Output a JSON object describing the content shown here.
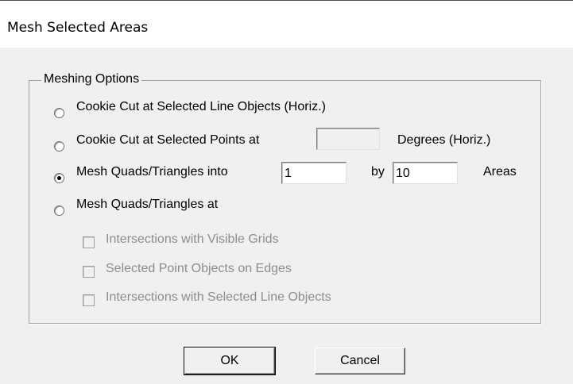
{
  "window": {
    "title": "Mesh Selected Areas"
  },
  "group": {
    "label": "Meshing Options"
  },
  "options": [
    {
      "label": "Cookie Cut at Selected Line Objects (Horiz.)",
      "checked": false
    },
    {
      "label": "Cookie Cut at Selected Points at",
      "suffix": "Degrees (Horiz.)",
      "value": "",
      "checked": false
    },
    {
      "label": "Mesh Quads/Triangles into",
      "value1": "1",
      "by": "by",
      "value2": "10",
      "suffix": "Areas",
      "checked": true
    },
    {
      "label": "Mesh Quads/Triangles at",
      "checked": false
    }
  ],
  "suboptions": [
    {
      "label": "Intersections with Visible Grids",
      "checked": false,
      "enabled": false
    },
    {
      "label": "Selected Point Objects on Edges",
      "checked": false,
      "enabled": false
    },
    {
      "label": "Intersections with Selected Line Objects",
      "checked": false,
      "enabled": false
    }
  ],
  "buttons": {
    "ok": "OK",
    "cancel": "Cancel"
  }
}
